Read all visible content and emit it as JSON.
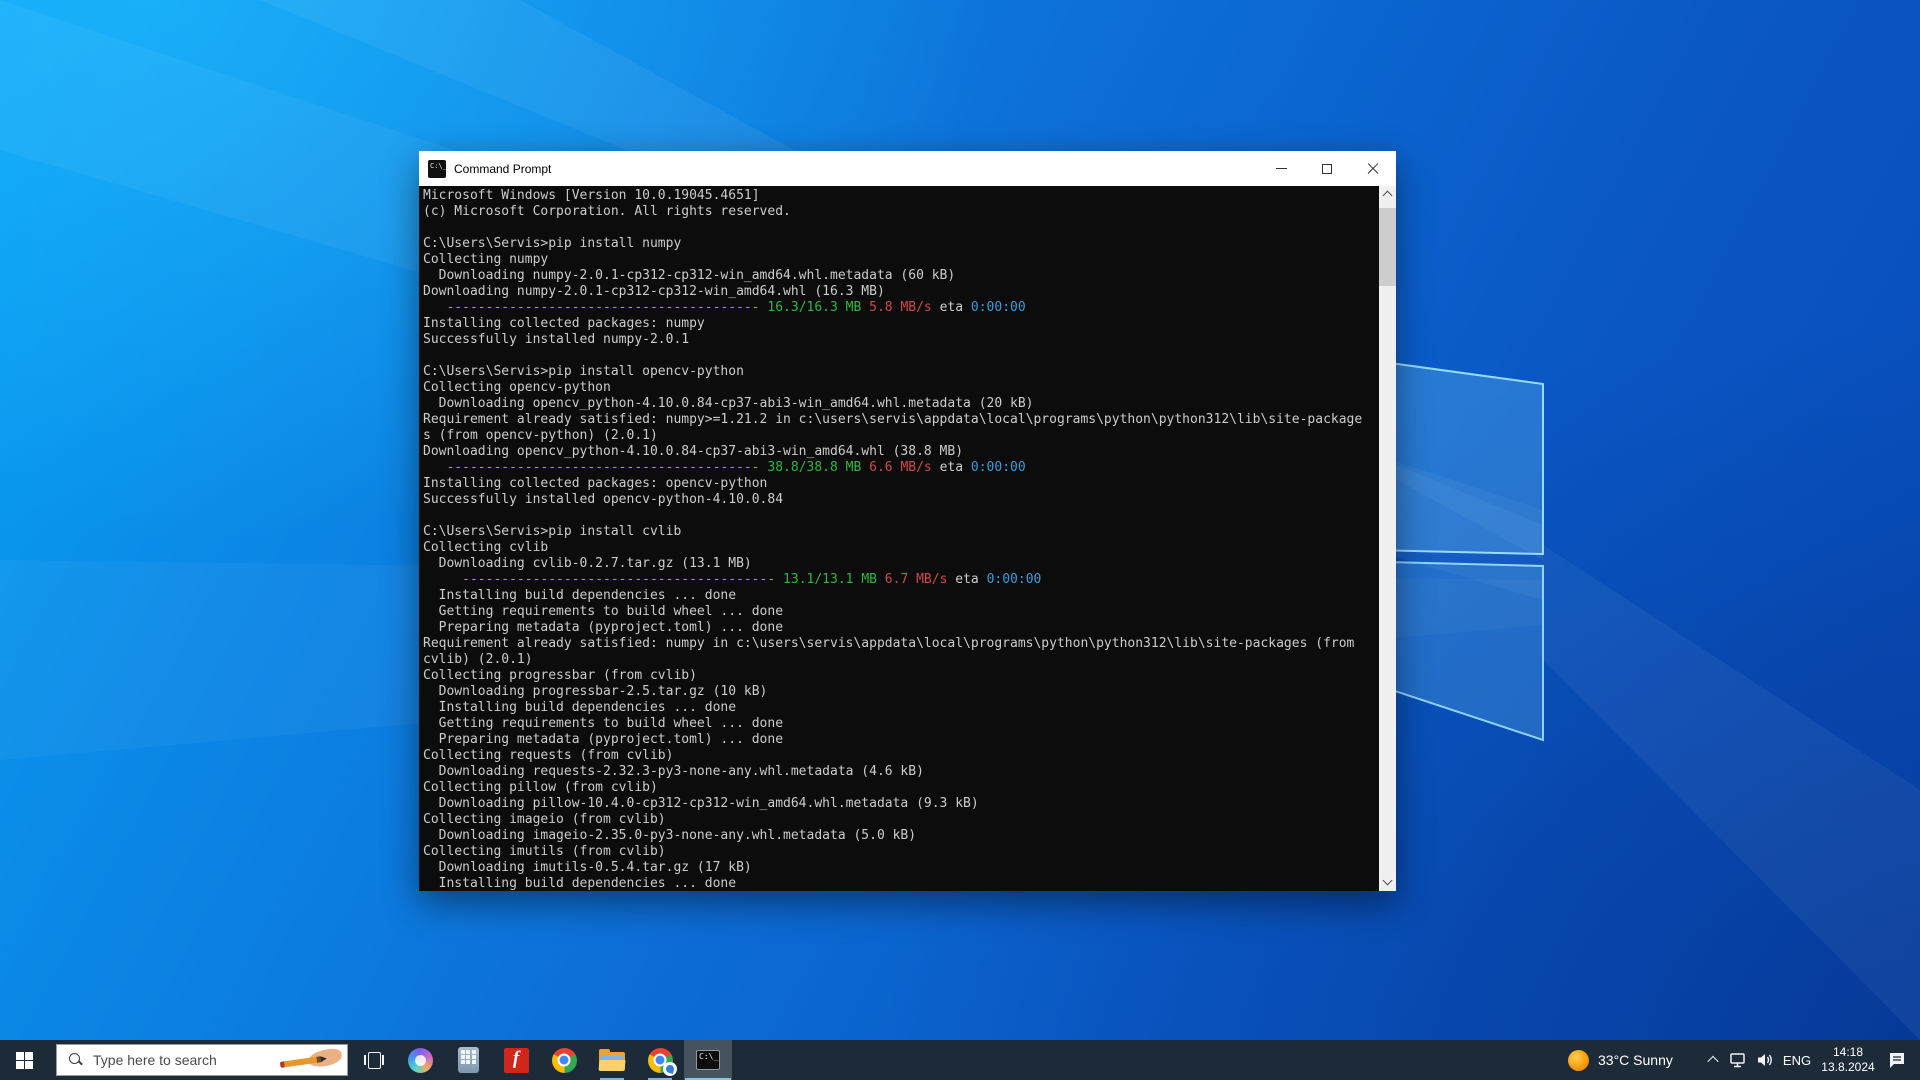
{
  "window": {
    "title": "Command Prompt",
    "cmd_icon_glyph": "C:\\_"
  },
  "console": {
    "colors": {
      "fg": "#cccccc",
      "green": "#2db83d",
      "red": "#d04a4a",
      "cyan": "#3b9ddd",
      "yellow": "#b3a04d"
    },
    "lines": [
      [
        [
          "fg",
          "Microsoft Windows [Version 10.0.19045.4651]"
        ]
      ],
      [
        [
          "fg",
          "(c) Microsoft Corporation. All rights reserved."
        ]
      ],
      [
        [
          "fg",
          ""
        ]
      ],
      [
        [
          "fg",
          "C:\\Users\\Servis>pip install numpy"
        ]
      ],
      [
        [
          "fg",
          "Collecting numpy"
        ]
      ],
      [
        [
          "fg",
          "  Downloading numpy-2.0.1-cp312-cp312-win_amd64.whl.metadata (60 kB)"
        ]
      ],
      [
        [
          "fg",
          "Downloading numpy-2.0.1-cp312-cp312-win_amd64.whl (16.3 MB)"
        ]
      ],
      [
        [
          "fg",
          "   "
        ],
        [
          "yellow",
          "---------------------------------------- "
        ],
        [
          "green",
          "16.3/16.3 MB"
        ],
        [
          "fg",
          " "
        ],
        [
          "red",
          "5.8 MB/s"
        ],
        [
          "fg",
          " eta "
        ],
        [
          "cyan",
          "0:00:00"
        ]
      ],
      [
        [
          "fg",
          "Installing collected packages: numpy"
        ]
      ],
      [
        [
          "fg",
          "Successfully installed numpy-2.0.1"
        ]
      ],
      [
        [
          "fg",
          ""
        ]
      ],
      [
        [
          "fg",
          "C:\\Users\\Servis>pip install opencv-python"
        ]
      ],
      [
        [
          "fg",
          "Collecting opencv-python"
        ]
      ],
      [
        [
          "fg",
          "  Downloading opencv_python-4.10.0.84-cp37-abi3-win_amd64.whl.metadata (20 kB)"
        ]
      ],
      [
        [
          "fg",
          "Requirement already satisfied: numpy>=1.21.2 in c:\\users\\servis\\appdata\\local\\programs\\python\\python312\\lib\\site-package"
        ]
      ],
      [
        [
          "fg",
          "s (from opencv-python) (2.0.1)"
        ]
      ],
      [
        [
          "fg",
          "Downloading opencv_python-4.10.0.84-cp37-abi3-win_amd64.whl (38.8 MB)"
        ]
      ],
      [
        [
          "fg",
          "   "
        ],
        [
          "yellow",
          "---------------------------------------- "
        ],
        [
          "green",
          "38.8/38.8 MB"
        ],
        [
          "fg",
          " "
        ],
        [
          "red",
          "6.6 MB/s"
        ],
        [
          "fg",
          " eta "
        ],
        [
          "cyan",
          "0:00:00"
        ]
      ],
      [
        [
          "fg",
          "Installing collected packages: opencv-python"
        ]
      ],
      [
        [
          "fg",
          "Successfully installed opencv-python-4.10.0.84"
        ]
      ],
      [
        [
          "fg",
          ""
        ]
      ],
      [
        [
          "fg",
          "C:\\Users\\Servis>pip install cvlib"
        ]
      ],
      [
        [
          "fg",
          "Collecting cvlib"
        ]
      ],
      [
        [
          "fg",
          "  Downloading cvlib-0.2.7.tar.gz (13.1 MB)"
        ]
      ],
      [
        [
          "fg",
          "     "
        ],
        [
          "yellow",
          "---------------------------------------- "
        ],
        [
          "green",
          "13.1/13.1 MB"
        ],
        [
          "fg",
          " "
        ],
        [
          "red",
          "6.7 MB/s"
        ],
        [
          "fg",
          " eta "
        ],
        [
          "cyan",
          "0:00:00"
        ]
      ],
      [
        [
          "fg",
          "  Installing build dependencies ... done"
        ]
      ],
      [
        [
          "fg",
          "  Getting requirements to build wheel ... done"
        ]
      ],
      [
        [
          "fg",
          "  Preparing metadata (pyproject.toml) ... done"
        ]
      ],
      [
        [
          "fg",
          "Requirement already satisfied: numpy in c:\\users\\servis\\appdata\\local\\programs\\python\\python312\\lib\\site-packages (from"
        ]
      ],
      [
        [
          "fg",
          "cvlib) (2.0.1)"
        ]
      ],
      [
        [
          "fg",
          "Collecting progressbar (from cvlib)"
        ]
      ],
      [
        [
          "fg",
          "  Downloading progressbar-2.5.tar.gz (10 kB)"
        ]
      ],
      [
        [
          "fg",
          "  Installing build dependencies ... done"
        ]
      ],
      [
        [
          "fg",
          "  Getting requirements to build wheel ... done"
        ]
      ],
      [
        [
          "fg",
          "  Preparing metadata (pyproject.toml) ... done"
        ]
      ],
      [
        [
          "fg",
          "Collecting requests (from cvlib)"
        ]
      ],
      [
        [
          "fg",
          "  Downloading requests-2.32.3-py3-none-any.whl.metadata (4.6 kB)"
        ]
      ],
      [
        [
          "fg",
          "Collecting pillow (from cvlib)"
        ]
      ],
      [
        [
          "fg",
          "  Downloading pillow-10.4.0-cp312-cp312-win_amd64.whl.metadata (9.3 kB)"
        ]
      ],
      [
        [
          "fg",
          "Collecting imageio (from cvlib)"
        ]
      ],
      [
        [
          "fg",
          "  Downloading imageio-2.35.0-py3-none-any.whl.metadata (5.0 kB)"
        ]
      ],
      [
        [
          "fg",
          "Collecting imutils (from cvlib)"
        ]
      ],
      [
        [
          "fg",
          "  Downloading imutils-0.5.4.tar.gz (17 kB)"
        ]
      ],
      [
        [
          "fg",
          "  Installing build dependencies ... done"
        ]
      ]
    ]
  },
  "taskbar": {
    "search": {
      "placeholder": "Type here to search"
    },
    "apps": [
      {
        "name": "task-view",
        "open": false,
        "active": false
      },
      {
        "name": "copilot",
        "open": false,
        "active": false
      },
      {
        "name": "calculator",
        "open": false,
        "active": false
      },
      {
        "name": "f-app",
        "open": false,
        "active": false
      },
      {
        "name": "chrome",
        "open": false,
        "active": false
      },
      {
        "name": "file-explorer",
        "open": true,
        "active": false
      },
      {
        "name": "chrome-profile",
        "open": true,
        "active": false
      },
      {
        "name": "command-prompt",
        "open": true,
        "active": true
      }
    ],
    "tray": {
      "weather_temp": "33°C",
      "weather_condition": "Sunny",
      "language": "ENG",
      "time": "14:18",
      "date": "13.8.2024"
    }
  }
}
